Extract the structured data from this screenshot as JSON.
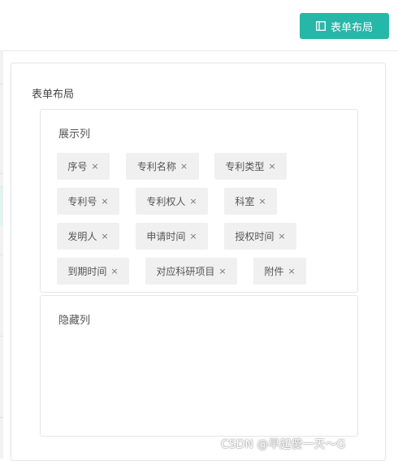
{
  "toolbar": {
    "button_label": "表单布局",
    "button_icon": "layout-icon",
    "button_color": "#26b7a8"
  },
  "dialog": {
    "title": "表单布局",
    "shown_section": {
      "label": "展示列",
      "tags": [
        {
          "label": "序号",
          "close": "×"
        },
        {
          "label": "专利名称",
          "close": "×"
        },
        {
          "label": "专利类型",
          "close": "×"
        },
        {
          "label": "专利号",
          "close": "×"
        },
        {
          "label": "专利权人",
          "close": "×"
        },
        {
          "label": "科室",
          "close": "×"
        },
        {
          "label": "发明人",
          "close": "×"
        },
        {
          "label": "申请时间",
          "close": "×"
        },
        {
          "label": "授权时间",
          "close": "×"
        },
        {
          "label": "到期时间",
          "close": "×"
        },
        {
          "label": "对应科研项目",
          "close": "×"
        },
        {
          "label": "附件",
          "close": "×"
        }
      ]
    },
    "hidden_section": {
      "label": "隐藏列",
      "tags": []
    }
  },
  "watermark": "CSDN @早起傻一天～G"
}
